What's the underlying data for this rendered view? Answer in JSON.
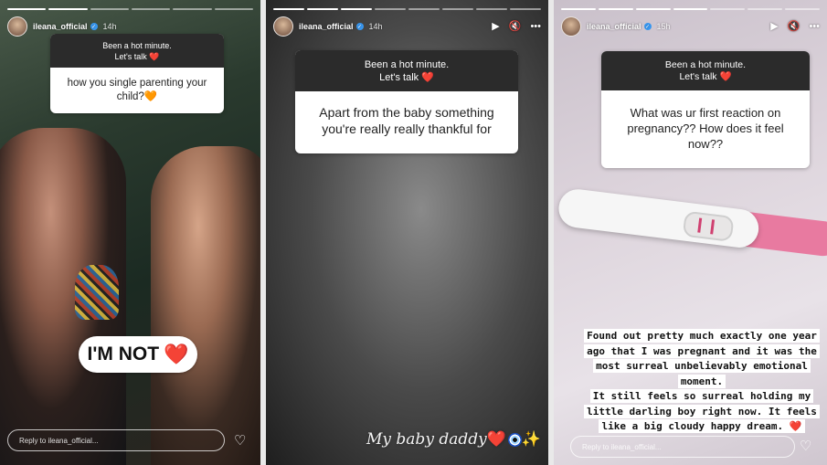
{
  "stories": [
    {
      "username": "ileana_official",
      "time": "14h",
      "question_header": [
        "Been a hot minute.",
        "Let's talk"
      ],
      "question_heart": "❤️",
      "answer_text": "how you single parenting your child?",
      "answer_emoji": "🧡",
      "sticker_text": "I'M NOT",
      "sticker_heart": "❤️",
      "reply_placeholder": "Reply to ileana_official..."
    },
    {
      "username": "ileana_official",
      "time": "14h",
      "question_header": [
        "Been a hot minute.",
        "Let's talk"
      ],
      "question_heart": "❤️",
      "answer_text": "Apart from the baby something you're really really thankful for",
      "caption_text": "My baby daddy",
      "caption_heart": "❤️",
      "caption_sparkle": "✨"
    },
    {
      "username": "ileana_official",
      "time": "15h",
      "question_header": [
        "Been a hot minute.",
        "Let's talk"
      ],
      "question_heart": "❤️",
      "answer_text": "What was ur first reaction on pregnancy?? How does it feel now??",
      "story_text_1": "Found out pretty much exactly one year ago that I was pregnant and it was the most surreal unbelievably emotional moment.",
      "story_text_2": "It still feels so surreal holding my little darling boy right now. It feels like a big cloudy happy dream.",
      "story_text_heart": "❤️",
      "reply_placeholder": "Reply to ileana_official..."
    }
  ],
  "icons": {
    "play": "▶",
    "mute": "🔇",
    "more": "•••",
    "like": "♡",
    "verified": "✓"
  },
  "colors": {
    "question_header_bg": "#2b2b2b",
    "heart": "#e0245e",
    "pregnancy_test_cap": "#e87aa0"
  }
}
